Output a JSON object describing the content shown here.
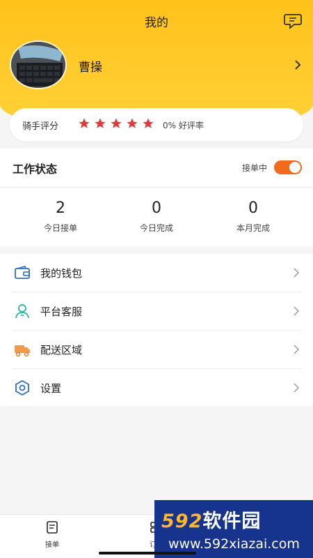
{
  "header": {
    "title": "我的",
    "message_icon": "chat-bubble-icon",
    "username": "曹操"
  },
  "rating": {
    "label": "骑手评分",
    "stars": 5,
    "star_color": "#e23b3b",
    "rate_text": "0% 好评率"
  },
  "work_status": {
    "label": "工作状态",
    "state_text": "接单中",
    "toggle_on": true,
    "toggle_color": "#f26a1b"
  },
  "stats": [
    {
      "value": "2",
      "label": "今日接单"
    },
    {
      "value": "0",
      "label": "今日完成"
    },
    {
      "value": "0",
      "label": "本月完成"
    }
  ],
  "menu": [
    {
      "label": "我的钱包",
      "icon": "wallet-icon"
    },
    {
      "label": "平台客服",
      "icon": "customer-service-icon"
    },
    {
      "label": "配送区域",
      "icon": "delivery-truck-icon"
    },
    {
      "label": "设置",
      "icon": "settings-icon"
    }
  ],
  "tabbar": [
    {
      "label": "接单",
      "icon": "order-list-icon"
    },
    {
      "label": "订单",
      "icon": "orders-icon"
    }
  ],
  "watermark": {
    "top_text_accent": "592",
    "top_text": "软件园",
    "bottom_text": "www.592xiazai.com"
  },
  "colors": {
    "header": "#ffc21a",
    "background": "#f5f5f5"
  }
}
